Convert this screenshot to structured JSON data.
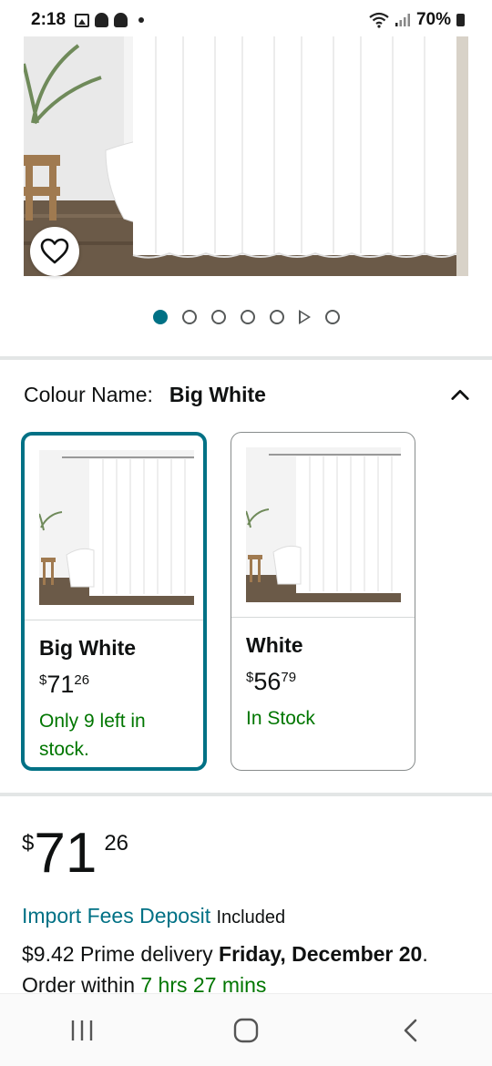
{
  "status_bar": {
    "time": "2:18",
    "battery": "70%",
    "notification_icons": [
      "gallery-icon",
      "snapchat-icon",
      "snapchat-icon"
    ]
  },
  "product": {
    "image_count": 7,
    "active_index": 0,
    "dots": [
      "active",
      "dot",
      "dot",
      "dot",
      "dot",
      "video",
      "dot"
    ]
  },
  "colour": {
    "label": "Colour Name:",
    "selected": "Big White"
  },
  "variants": [
    {
      "name": "Big White",
      "currency": "$",
      "price_whole": "71",
      "price_fraction": "26",
      "stock": "Only 9 left in stock.",
      "selected": true
    },
    {
      "name": "White",
      "currency": "$",
      "price_whole": "56",
      "price_fraction": "79",
      "stock": "In Stock",
      "selected": false
    }
  ],
  "price": {
    "currency": "$",
    "whole": "71",
    "fraction": "26"
  },
  "fees": {
    "link": "Import Fees Deposit",
    "suffix": "Included"
  },
  "delivery": {
    "prefix": "$9.42 Prime delivery ",
    "date": "Friday, December 20",
    "after_date": ".",
    "order_within": "Order within ",
    "time_left": "7 hrs 27 mins"
  },
  "colors": {
    "accent": "#007185",
    "in_stock": "#007600",
    "divider": "#e3e6e6"
  }
}
